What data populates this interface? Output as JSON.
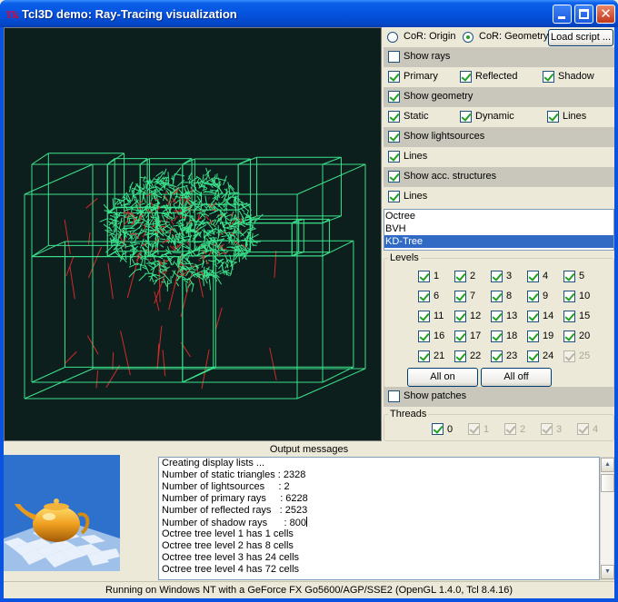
{
  "window": {
    "icon_text": "Tk",
    "title": "Tcl3D demo: Ray-Tracing visualization"
  },
  "colors": {
    "wireframe": "#3be28c",
    "rays": "#d42a2a",
    "selection": "#316ac5",
    "titlebar": "#0553e0"
  },
  "cor": {
    "origin_label": "CoR: Origin",
    "origin_selected": false,
    "geometry_label": "CoR: Geometry",
    "geometry_selected": true,
    "load_button": "Load script ..."
  },
  "rays": {
    "show_label": "Show rays",
    "show_checked": false,
    "primary": "Primary",
    "reflected": "Reflected",
    "shadow": "Shadow"
  },
  "geometry": {
    "show_label": "Show geometry",
    "show_checked": true,
    "static": "Static",
    "dynamic": "Dynamic",
    "lines": "Lines"
  },
  "lights": {
    "show_label": "Show lightsources",
    "show_checked": true,
    "lines": "Lines"
  },
  "acc": {
    "show_label": "Show acc. structures",
    "show_checked": true,
    "lines": "Lines"
  },
  "structures": [
    "Octree",
    "BVH",
    "KD-Tree"
  ],
  "structures_selected": "KD-Tree",
  "levels": {
    "title": "Levels",
    "items": [
      "1",
      "2",
      "3",
      "4",
      "5",
      "6",
      "7",
      "8",
      "9",
      "10",
      "11",
      "12",
      "13",
      "14",
      "15",
      "16",
      "17",
      "18",
      "19",
      "20",
      "21",
      "22",
      "23",
      "24",
      "25"
    ],
    "disabled": [
      "25"
    ],
    "all_on": "All on",
    "all_off": "All off"
  },
  "patches": {
    "show_label": "Show patches",
    "show_checked": false
  },
  "threads": {
    "title": "Threads",
    "items": [
      "0",
      "1",
      "2",
      "3",
      "4"
    ],
    "enabled": [
      "0"
    ]
  },
  "output": {
    "title": "Output messages",
    "lines": [
      "Creating display lists ...",
      "Number of static triangles : 2328",
      "Number of lightsources     : 2",
      "Number of primary rays     : 6228",
      "Number of reflected rays   : 2523",
      "Number of shadow rays      : 800",
      "Octree tree level 1 has 1 cells",
      "Octree tree level 2 has 8 cells",
      "Octree tree level 3 has 24 cells",
      "Octree tree level 4 has 72 cells"
    ]
  },
  "status": "Running on Windows NT with a GeForce FX Go5600/AGP/SSE2 (OpenGL 1.4.0, Tcl 8.4.16)"
}
